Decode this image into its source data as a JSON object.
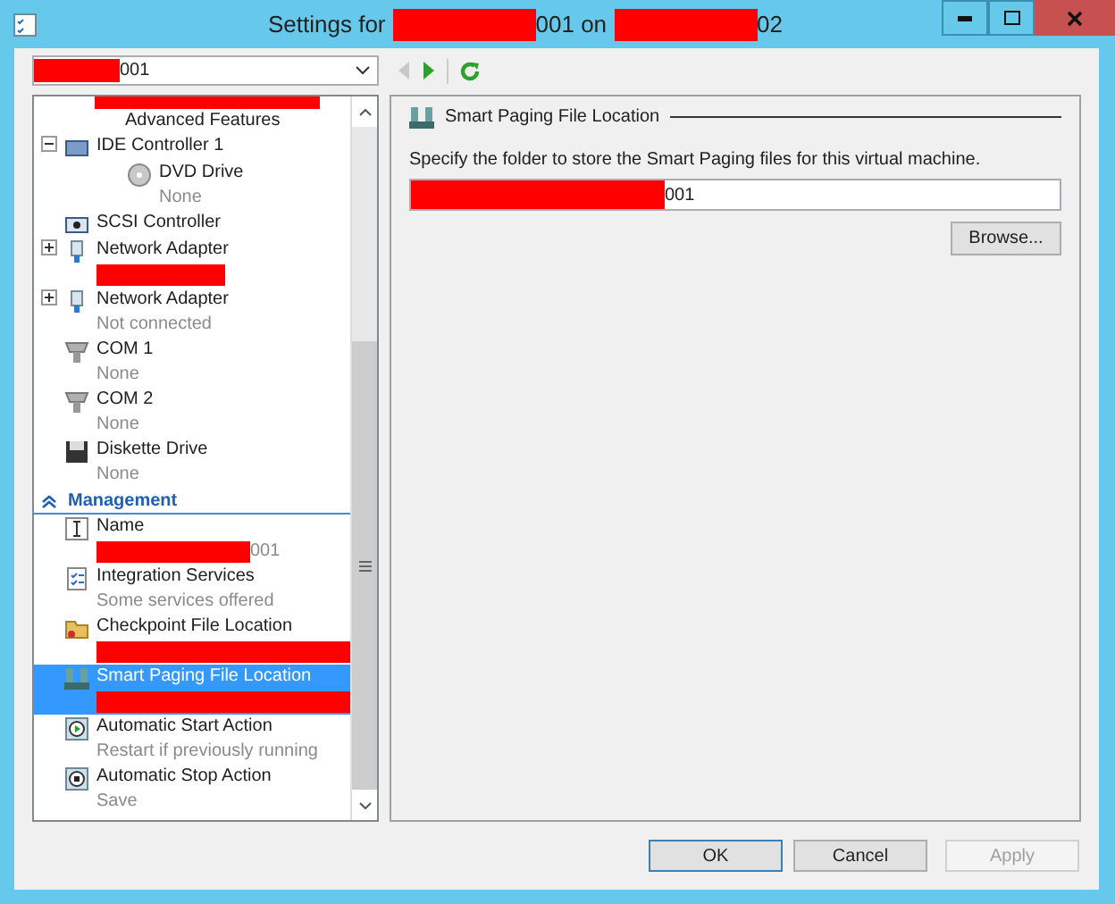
{
  "window": {
    "title": [
      {
        "kind": "text",
        "text": "Settings for"
      },
      {
        "kind": "redaction"
      },
      {
        "kind": "text",
        "text": "001 on"
      },
      {
        "kind": "redaction"
      },
      {
        "kind": "text",
        "text": "02"
      }
    ]
  },
  "vm_select": {
    "value": [
      {
        "kind": "redaction"
      },
      {
        "kind": "text",
        "text": "001"
      }
    ]
  },
  "nav": {
    "back_disabled": true,
    "forward_disabled": false
  },
  "tree": [
    {
      "kind": "partial",
      "sub": [
        {
          "kind": "redaction"
        }
      ]
    },
    {
      "kind": "feature",
      "label": "Advanced Features",
      "selected": false
    },
    {
      "kind": "controller",
      "label": "IDE Controller 1",
      "expanded": true,
      "selected": false,
      "children": [
        {
          "kind": "drive",
          "label": "DVD Drive",
          "sub": [
            {
              "kind": "text",
              "text": "None"
            }
          ],
          "selected": false
        }
      ]
    },
    {
      "kind": "scsi",
      "label": "SCSI Controller",
      "selected": false
    },
    {
      "kind": "network",
      "label": "Network Adapter",
      "expanded": false,
      "sub": [
        {
          "kind": "redaction"
        }
      ],
      "selected": false
    },
    {
      "kind": "network",
      "label": "Network Adapter",
      "expanded": false,
      "sub": [
        {
          "kind": "text",
          "text": "Not connected"
        }
      ],
      "selected": false
    },
    {
      "kind": "port",
      "label": "COM 1",
      "sub": [
        {
          "kind": "text",
          "text": "None"
        }
      ],
      "selected": false
    },
    {
      "kind": "port",
      "label": "COM 2",
      "sub": [
        {
          "kind": "text",
          "text": "None"
        }
      ],
      "selected": false
    },
    {
      "kind": "floppy",
      "label": "Diskette Drive",
      "sub": [
        {
          "kind": "text",
          "text": "None"
        }
      ],
      "selected": false
    },
    {
      "kind": "header",
      "label": "Management"
    },
    {
      "kind": "name",
      "label": "Name",
      "sub": [
        {
          "kind": "redaction"
        },
        {
          "kind": "text",
          "text": "001"
        }
      ],
      "selected": false
    },
    {
      "kind": "services",
      "label": "Integration Services",
      "sub": [
        {
          "kind": "text",
          "text": "Some services offered"
        }
      ],
      "selected": false
    },
    {
      "kind": "folder",
      "label": "Checkpoint File Location",
      "sub": [
        {
          "kind": "redaction"
        }
      ],
      "selected": false
    },
    {
      "kind": "paging",
      "label": "Smart Paging File Location",
      "sub": [
        {
          "kind": "redaction"
        }
      ],
      "selected": true
    },
    {
      "kind": "start",
      "label": "Automatic Start Action",
      "sub": [
        {
          "kind": "text",
          "text": "Restart if previously running"
        }
      ],
      "selected": false
    },
    {
      "kind": "stop",
      "label": "Automatic Stop Action",
      "sub": [
        {
          "kind": "text",
          "text": "Save"
        }
      ],
      "selected": false
    }
  ],
  "panel": {
    "title": "Smart Paging File Location",
    "description": "Specify the folder to store the Smart Paging files for this virtual machine.",
    "path": [
      {
        "kind": "redaction"
      },
      {
        "kind": "text",
        "text": "001"
      }
    ],
    "browse": "Browse..."
  },
  "buttons": [
    {
      "label": "OK",
      "disabled": false,
      "default": true
    },
    {
      "label": "Cancel",
      "disabled": false,
      "default": false
    },
    {
      "label": "Apply",
      "disabled": true,
      "default": false
    }
  ]
}
